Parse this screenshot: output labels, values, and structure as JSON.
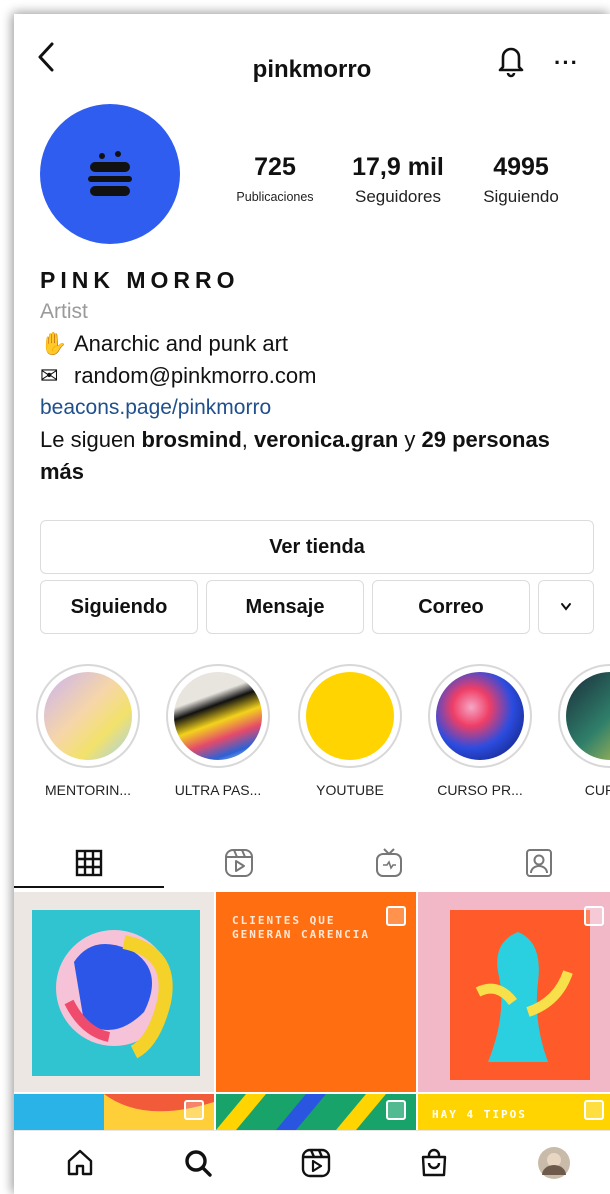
{
  "header": {
    "username": "pinkmorro",
    "more": "···"
  },
  "avatar": {
    "text": "PINK MORRO"
  },
  "stats": [
    {
      "value": "725",
      "label": "Publicaciones"
    },
    {
      "value": "17,9 mil",
      "label": "Seguidores"
    },
    {
      "value": "4995",
      "label": "Siguiendo"
    }
  ],
  "bio": {
    "name": "PINK MORRO",
    "category": "Artist",
    "line1_emoji": "✋",
    "line1": "Anarchic and punk art",
    "line2_emoji": "✉",
    "line2": "random@pinkmorro.com",
    "link": "beacons.page/pinkmorro",
    "followed_prefix": "Le siguen ",
    "followed_name1": "brosmind",
    "followed_sep": ", ",
    "followed_name2": "veronica.gran",
    "followed_mid": " y ",
    "followed_count": "29 personas más"
  },
  "buttons": {
    "shop": "Ver tienda",
    "following": "Siguiendo",
    "message": "Mensaje",
    "mail": "Correo",
    "more": "⌄"
  },
  "highlights": [
    {
      "label": "MENTORIN..."
    },
    {
      "label": "ULTRA PAS..."
    },
    {
      "label": "YOUTUBE"
    },
    {
      "label": "CURSO PR..."
    },
    {
      "label": "CURSO"
    }
  ],
  "tabs": [
    {
      "icon": "grid-icon"
    },
    {
      "icon": "reels-icon"
    },
    {
      "icon": "igtv-icon"
    },
    {
      "icon": "tagged-icon"
    }
  ],
  "grid": {
    "post2_text": "CLIENTES QUE GENERAN CARENCIA",
    "post6_text": "HAY 4 TIPOS"
  },
  "bottom_nav": [
    {
      "icon": "home-icon"
    },
    {
      "icon": "search-icon"
    },
    {
      "icon": "reels-icon"
    },
    {
      "icon": "shop-icon"
    },
    {
      "icon": "profile-avatar"
    }
  ],
  "colors": {
    "link": "#1f4f8c",
    "avatar": "#2f5df0",
    "orange": "#ff6f12",
    "yellow": "#ffd400"
  }
}
